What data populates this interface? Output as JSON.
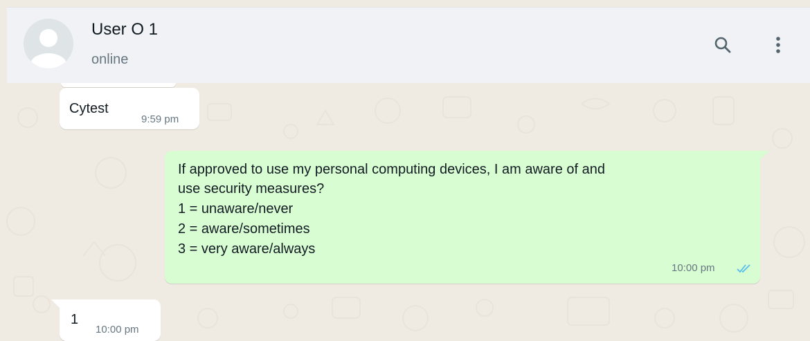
{
  "contact": {
    "name": "User O 1",
    "status": "online"
  },
  "header_icons": [
    "search-icon",
    "menu-dots-icon",
    "avatar-placeholder-icon"
  ],
  "messages": [
    {
      "direction": "incoming",
      "text": "Cytest",
      "time": "9:59 pm"
    },
    {
      "direction": "outgoing",
      "lines": [
        "If approved to use my personal computing devices, I am aware of and",
        "use security measures?",
        "1 = unaware/never",
        "2 = aware/sometimes",
        "3 = very aware/always"
      ],
      "time": "10:00 pm",
      "status_icon": "double-check-read-icon"
    },
    {
      "direction": "incoming",
      "text": "1",
      "time": "10:00 pm"
    }
  ],
  "colors": {
    "header_bg": "#f0f2f5",
    "chat_bg": "#efeae2",
    "incoming_bubble": "#ffffff",
    "outgoing_bubble": "#d9fdd3",
    "read_ticks": "#53bdeb",
    "secondary_text": "#667781"
  }
}
